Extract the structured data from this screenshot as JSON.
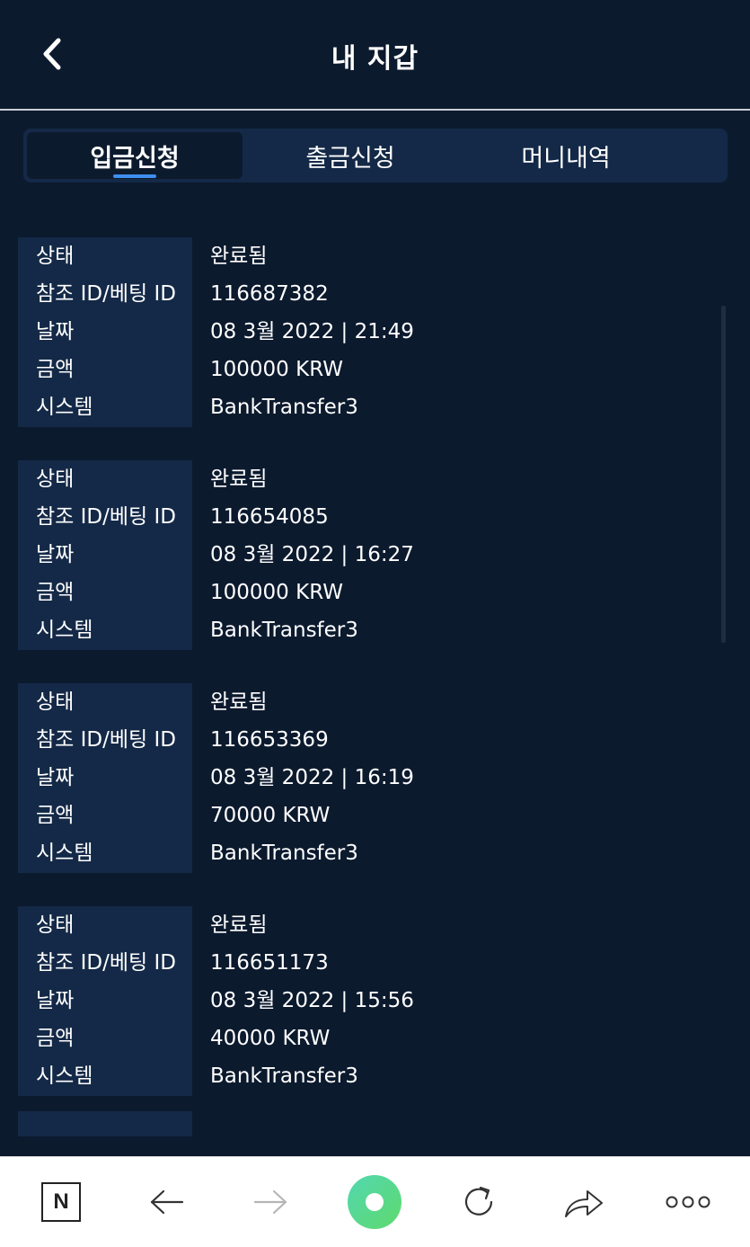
{
  "header": {
    "title": "내 지갑"
  },
  "tabs": [
    {
      "label": "입금신청",
      "active": true
    },
    {
      "label": "출금신청",
      "active": false
    },
    {
      "label": "머니내역",
      "active": false
    }
  ],
  "labels": {
    "status": "상태",
    "ref": "참조 ID/베팅 ID",
    "date": "날짜",
    "amount": "금액",
    "system": "시스템"
  },
  "records": [
    {
      "status": "완료됨",
      "ref": "116687382",
      "date": "08 3월 2022 | 21:49",
      "amount": "100000 KRW",
      "system": "BankTransfer3"
    },
    {
      "status": "완료됨",
      "ref": "116654085",
      "date": "08 3월 2022 | 16:27",
      "amount": "100000 KRW",
      "system": "BankTransfer3"
    },
    {
      "status": "완료됨",
      "ref": "116653369",
      "date": "08 3월 2022 | 16:19",
      "amount": "70000 KRW",
      "system": "BankTransfer3"
    },
    {
      "status": "완료됨",
      "ref": "116651173",
      "date": "08 3월 2022 | 15:56",
      "amount": "40000 KRW",
      "system": "BankTransfer3"
    }
  ],
  "browser_bar": {
    "icons": [
      "naver-n-icon",
      "back-arrow-icon",
      "forward-arrow-icon",
      "home-dot-icon",
      "reload-icon",
      "share-icon",
      "more-icon"
    ],
    "n_label": "N",
    "accent": "#52d8b0"
  },
  "colors": {
    "background": "#0c1a2e",
    "panel": "#142947",
    "tab_underline": "#3d8ef0"
  }
}
